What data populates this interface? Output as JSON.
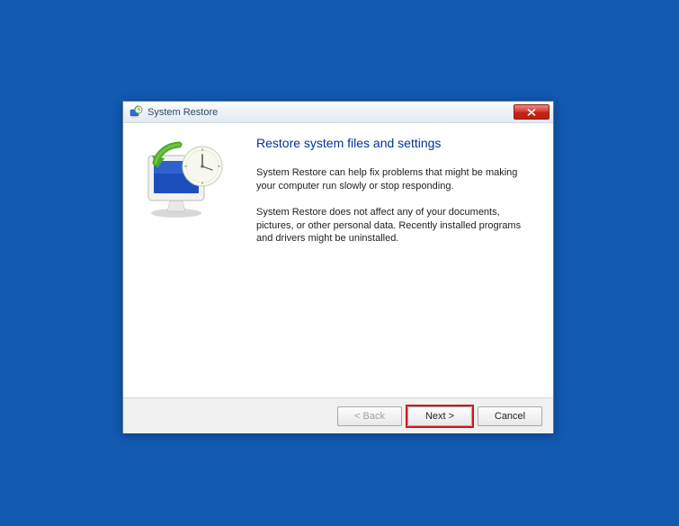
{
  "window": {
    "title": "System Restore"
  },
  "content": {
    "heading": "Restore system files and settings",
    "paragraph1": "System Restore can help fix problems that might be making your computer run slowly or stop responding.",
    "paragraph2": "System Restore does not affect any of your documents, pictures, or other personal data. Recently installed programs and drivers might be uninstalled."
  },
  "buttons": {
    "back": "< Back",
    "next": "Next >",
    "cancel": "Cancel"
  }
}
